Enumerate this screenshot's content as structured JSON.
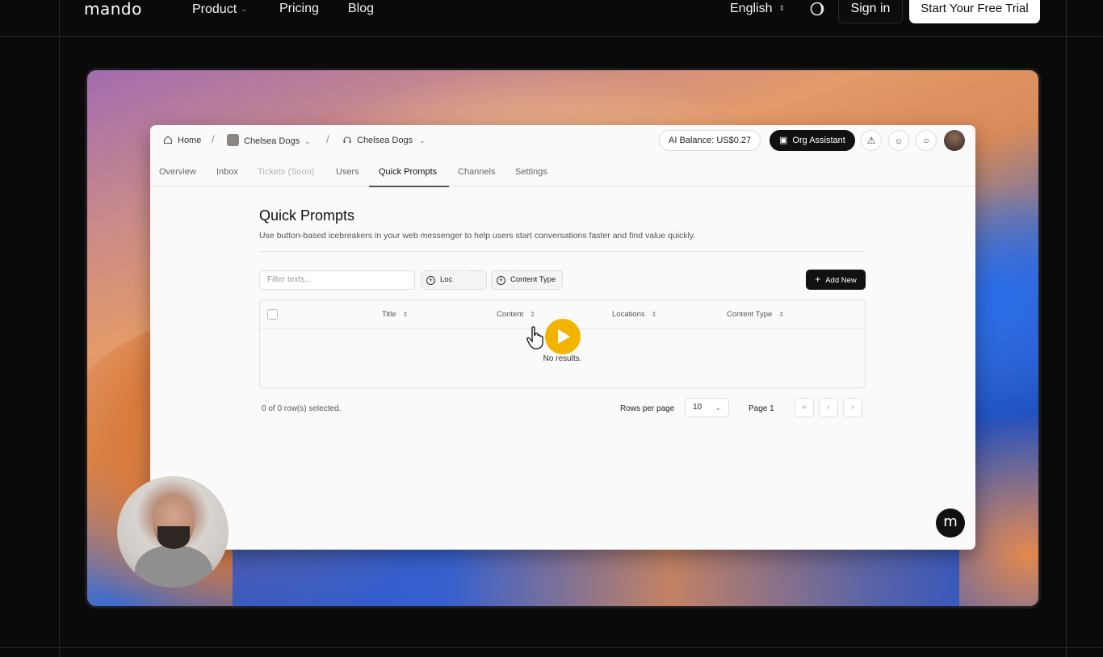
{
  "nav": {
    "logo": "mando",
    "product": "Product",
    "pricing": "Pricing",
    "blog": "Blog",
    "language": "English",
    "signin": "Sign in",
    "trial": "Start Your Free Trial"
  },
  "app": {
    "breadcrumb": {
      "home": "Home",
      "org": "Chelsea Dogs",
      "channel": "Chelsea Dogs"
    },
    "balance": "AI Balance:  US$0.27",
    "assistant": "Org Assistant",
    "tabs": [
      "Overview",
      "Inbox",
      "Tickets (Soon)",
      "Users",
      "Quick Prompts",
      "Channels",
      "Settings"
    ],
    "page_title": "Quick Prompts",
    "page_sub": "Use button-based icebreakers in your web messenger to help users start conversations faster and find value quickly.",
    "filter_placeholder": "Filter texts...",
    "chip_locations": "Loc",
    "chip_content_type": "Content Type",
    "add_new": "Add New",
    "columns": [
      "Title",
      "Content",
      "Locations",
      "Content Type"
    ],
    "no_results": "No results.",
    "selected": "0 of 0 row(s) selected.",
    "rows_per_page_label": "Rows per page",
    "rows_per_page": "10",
    "page": "Page 1"
  },
  "colors": {
    "accent_play": "#f2b400",
    "nav_bg": "#0a0a0b"
  }
}
